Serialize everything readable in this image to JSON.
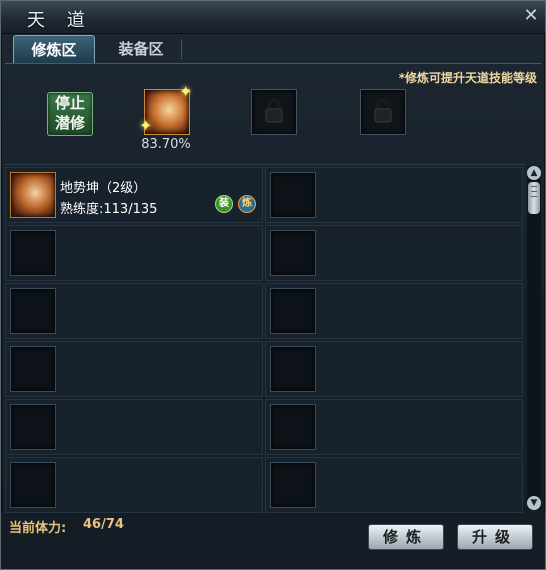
{
  "window": {
    "title": "天 道"
  },
  "tabs": [
    {
      "label": "修炼区",
      "active": true
    },
    {
      "label": "装备区",
      "active": false
    }
  ],
  "hint": "*修炼可提升天道技能等级",
  "stop_button": {
    "line1": "停止",
    "line2": "潜修"
  },
  "cultivation": {
    "active_skill_icon": "fist-skill-icon",
    "progress_text": "83.70%",
    "locked_slots": 2
  },
  "skills": [
    {
      "name": "地势坤（2级）",
      "proficiency": "熟练度:113/135",
      "badges": [
        {
          "text": "装",
          "meaning": "equip"
        },
        {
          "text": "炼",
          "meaning": "train"
        }
      ]
    }
  ],
  "footer": {
    "stamina_label": "当前体力:",
    "stamina_value": "46/74",
    "train_button": "修炼",
    "upgrade_button": "升级"
  },
  "colors": {
    "accent_gold": "#e9c27a",
    "hint": "#f0d8a0",
    "stop_button": "#2f6a3a"
  }
}
